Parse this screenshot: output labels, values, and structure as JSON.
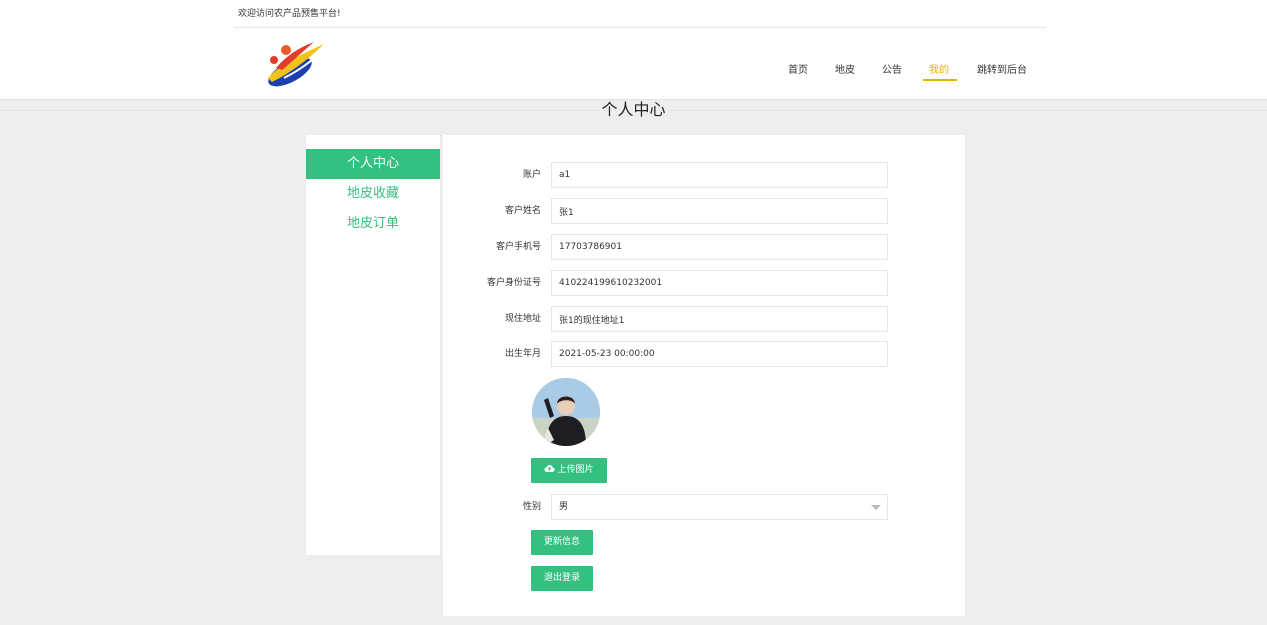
{
  "header": {
    "welcome": "欢迎访问农产品预售平台!",
    "nav": [
      {
        "label": "首页",
        "active": false
      },
      {
        "label": "地皮",
        "active": false
      },
      {
        "label": "公告",
        "active": false
      },
      {
        "label": "我的",
        "active": true
      },
      {
        "label": "跳转到后台",
        "active": false
      }
    ]
  },
  "page_title": "个人中心",
  "sidebar": {
    "items": [
      {
        "label": "个人中心",
        "active": true
      },
      {
        "label": "地皮收藏",
        "active": false
      },
      {
        "label": "地皮订单",
        "active": false
      }
    ]
  },
  "form": {
    "fields": [
      {
        "label": "账户",
        "value": "a1"
      },
      {
        "label": "客户姓名",
        "value": "张1"
      },
      {
        "label": "客户手机号",
        "value": "17703786901"
      },
      {
        "label": "客户身份证号",
        "value": "410224199610232001"
      },
      {
        "label": "现住地址",
        "value": "张1的现住地址1"
      },
      {
        "label": "出生年月",
        "value": "2021-05-23 00:00:00"
      }
    ],
    "upload_label": "上传图片",
    "gender_label": "性别",
    "gender_value": "男",
    "update_label": "更新信息",
    "logout_label": "退出登录"
  },
  "colors": {
    "accent_green": "#34c080",
    "nav_active": "#e8b00a"
  },
  "icons": {
    "upload": "cloud-upload-icon",
    "dropdown": "chevron-down-icon"
  }
}
